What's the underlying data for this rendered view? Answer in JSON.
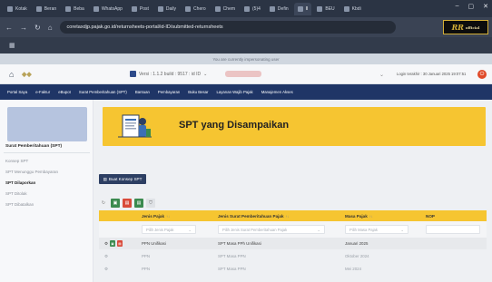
{
  "browser": {
    "tabs": [
      {
        "label": "Kotak"
      },
      {
        "label": "Beran"
      },
      {
        "label": "Beba"
      },
      {
        "label": "WhatsApp"
      },
      {
        "label": "Post"
      },
      {
        "label": "Daily"
      },
      {
        "label": "Chero"
      },
      {
        "label": "Chem"
      },
      {
        "label": "(5)4"
      },
      {
        "label": "Defin"
      },
      {
        "label": "II"
      },
      {
        "label": "BEU"
      },
      {
        "label": "Kbdi"
      }
    ],
    "url": "coretaxdjp.pajak.go.id/returnsheets-portal/id-ID/submitted-returnsheets"
  },
  "impersonation_banner": "You are currently impersonating user",
  "app_header": {
    "version": "Versi : 1.1.2 build : 9517 : id ID",
    "login_info": "Login terakhir : 30 Januari 2025 19:07:51"
  },
  "nav": {
    "items": [
      "Portal Saya",
      "e-Faktur",
      "eBupot",
      "Surat Pemberitahuan (SPT)",
      "Bantuan",
      "Pembayaran",
      "Buku Besar",
      "Layanan Wajib Pajak",
      "Manajemen Akses"
    ]
  },
  "sidebar": {
    "title": "Surat Pemberitahuan (SPT)",
    "items": [
      {
        "label": "Konsep SPT",
        "active": false
      },
      {
        "label": "SPT Menunggu Pembayaran",
        "active": false
      },
      {
        "label": "SPT Dilaporkan",
        "active": true
      },
      {
        "label": "SPT Ditolak",
        "active": false
      },
      {
        "label": "SPT Dibatalkan",
        "active": false
      }
    ]
  },
  "main": {
    "title": "SPT yang Disampaikan",
    "buat_button": "Buat Konsep SPT",
    "table": {
      "columns": [
        {
          "label": "Jenis Pajak",
          "sort": "↑↓"
        },
        {
          "label": "Jenis Surat Pemberitahuan Pajak",
          "sort": "↑↓"
        },
        {
          "label": "Masa Pajak",
          "sort": "↑↓"
        },
        {
          "label": "NOP",
          "sort": ""
        }
      ],
      "filters": [
        "Pilih Jenis Pajak",
        "Pilih Jenis Surat Pemberitahuan Pajak",
        "Pilih Masa Pajak"
      ],
      "rows": [
        {
          "jenis_pajak": "PPN Unifikasi",
          "jenis_spt": "SPT Masa PPh Unifikasi",
          "masa_pajak": "Januari 2025",
          "highlight": true
        },
        {
          "jenis_pajak": "PPN",
          "jenis_spt": "SPT Masa PPN",
          "masa_pajak": "Oktober 2024",
          "highlight": false
        },
        {
          "jenis_pajak": "PPN",
          "jenis_spt": "SPT Masa PPN",
          "masa_pajak": "Mei 2024",
          "highlight": false
        }
      ]
    }
  },
  "colors": {
    "nav_bg": "#1f3566",
    "accent_yellow": "#f6c531",
    "button_dark": "#2d3f63"
  }
}
